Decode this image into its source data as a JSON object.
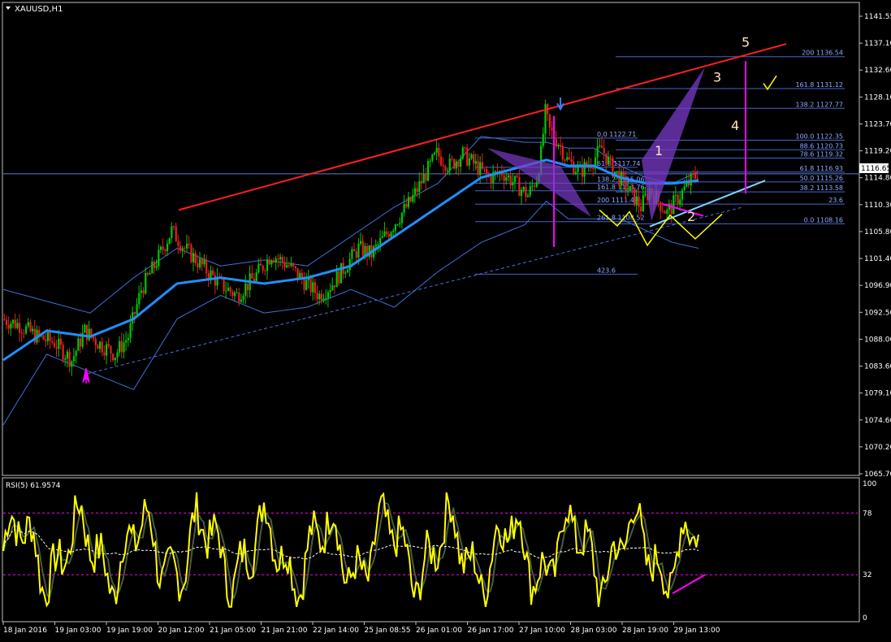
{
  "main_panel": {
    "title": "XAUUSD,H1",
    "current_price_label": "1116.65"
  },
  "rsi_panel": {
    "title": "RSI(5) 61.9574"
  },
  "colors": {
    "background": "#000000",
    "bull_candle": "#00c800",
    "bear_candle": "#e62020",
    "moving_average": "#1e90ff",
    "bollinger": "#3f6fd8",
    "trend_red": "#ff2020",
    "trend_cyan": "#7fd4ff",
    "fib": "#4466cc",
    "fib_text": "#8fa8ff",
    "rsi_line": "#ffff00",
    "magenta": "#ff00ff",
    "wave_label": "#ffe4c0",
    "zigzag": "#ffff00"
  },
  "chart_data": [
    {
      "type": "candlestick",
      "symbol": "XAUUSD",
      "timeframe": "H1",
      "y_axis_ticks": [
        "1141.55",
        "1137.10",
        "1132.60",
        "1128.10",
        "1123.70",
        "1119.20",
        "1114.80",
        "1110.30",
        "1105.80",
        "1101.40",
        "1096.90",
        "1092.50",
        "1088.00",
        "1083.60",
        "1079.10",
        "1074.60",
        "1070.20",
        "1065.70"
      ],
      "ylim": [
        1065.7,
        1143.4
      ],
      "x_axis_ticks": [
        "18 Jan 2016",
        "19 Jan 03:00",
        "19 Jan 19:00",
        "20 Jan 12:00",
        "21 Jan 05:00",
        "21 Jan 21:00",
        "22 Jan 14:00",
        "25 Jan 08:55",
        "26 Jan 01:00",
        "26 Jan 17:00",
        "27 Jan 10:00",
        "28 Jan 03:00",
        "28 Jan 19:00",
        "29 Jan 13:00"
      ],
      "price_path": [
        [
          0,
          1092
        ],
        [
          8,
          1091
        ],
        [
          16,
          1089
        ],
        [
          24,
          1088
        ],
        [
          32,
          1085
        ],
        [
          38,
          1090
        ],
        [
          44,
          1088
        ],
        [
          52,
          1086
        ],
        [
          58,
          1089
        ],
        [
          64,
          1097
        ],
        [
          70,
          1101
        ],
        [
          78,
          1107
        ],
        [
          84,
          1104
        ],
        [
          92,
          1101
        ],
        [
          100,
          1098
        ],
        [
          108,
          1096
        ],
        [
          116,
          1099
        ],
        [
          124,
          1103
        ],
        [
          132,
          1101
        ],
        [
          140,
          1098
        ],
        [
          146,
          1096
        ],
        [
          152,
          1098
        ],
        [
          158,
          1101
        ],
        [
          164,
          1104
        ],
        [
          170,
          1103
        ],
        [
          176,
          1106
        ],
        [
          182,
          1109
        ],
        [
          188,
          1112
        ],
        [
          194,
          1116
        ],
        [
          200,
          1120
        ],
        [
          206,
          1118
        ],
        [
          212,
          1120
        ],
        [
          218,
          1118
        ],
        [
          224,
          1116
        ],
        [
          230,
          1117
        ],
        [
          236,
          1115
        ],
        [
          242,
          1113
        ],
        [
          246,
          1116
        ],
        [
          248,
          1120
        ],
        [
          250,
          1127
        ],
        [
          252,
          1124
        ],
        [
          256,
          1122
        ],
        [
          260,
          1119
        ],
        [
          266,
          1117
        ],
        [
          272,
          1119
        ],
        [
          276,
          1121
        ],
        [
          280,
          1118
        ],
        [
          284,
          1116
        ],
        [
          290,
          1113
        ],
        [
          294,
          1111
        ],
        [
          298,
          1114
        ],
        [
          302,
          1112
        ],
        [
          306,
          1110
        ],
        [
          312,
          1113
        ],
        [
          316,
          1115
        ],
        [
          320,
          1116.65
        ]
      ],
      "moving_average": [
        [
          0,
          1085
        ],
        [
          20,
          1090
        ],
        [
          40,
          1089
        ],
        [
          60,
          1092
        ],
        [
          80,
          1098
        ],
        [
          100,
          1099
        ],
        [
          120,
          1098
        ],
        [
          140,
          1099
        ],
        [
          160,
          1101
        ],
        [
          180,
          1106
        ],
        [
          200,
          1111
        ],
        [
          220,
          1116
        ],
        [
          240,
          1118
        ],
        [
          250,
          1119
        ],
        [
          260,
          1118
        ],
        [
          272,
          1118
        ],
        [
          284,
          1116
        ],
        [
          296,
          1115
        ],
        [
          308,
          1115
        ],
        [
          320,
          1115.5
        ]
      ],
      "bollinger_upper": [
        [
          0,
          1097
        ],
        [
          20,
          1095
        ],
        [
          40,
          1093
        ],
        [
          60,
          1099
        ],
        [
          80,
          1104
        ],
        [
          100,
          1101
        ],
        [
          120,
          1102
        ],
        [
          140,
          1101
        ],
        [
          160,
          1106
        ],
        [
          180,
          1111
        ],
        [
          200,
          1115
        ],
        [
          220,
          1123
        ],
        [
          240,
          1122
        ],
        [
          250,
          1122
        ],
        [
          260,
          1121
        ],
        [
          272,
          1121
        ],
        [
          284,
          1118
        ],
        [
          296,
          1116
        ],
        [
          308,
          1115
        ],
        [
          320,
          1117
        ]
      ],
      "bollinger_lower": [
        [
          0,
          1074
        ],
        [
          20,
          1086
        ],
        [
          40,
          1083
        ],
        [
          60,
          1080
        ],
        [
          80,
          1092
        ],
        [
          100,
          1096
        ],
        [
          120,
          1093
        ],
        [
          140,
          1094
        ],
        [
          160,
          1097
        ],
        [
          180,
          1094
        ],
        [
          200,
          1100
        ],
        [
          220,
          1105
        ],
        [
          240,
          1108
        ],
        [
          250,
          1112
        ],
        [
          260,
          1109
        ],
        [
          272,
          1109
        ],
        [
          284,
          1109
        ],
        [
          296,
          1107
        ],
        [
          308,
          1105
        ],
        [
          320,
          1104
        ]
      ],
      "fib_levels_left": [
        {
          "label": "0.0 1122.71",
          "price": 1122.71
        },
        {
          "label": "61.8 1117.74",
          "price": 1117.74
        },
        {
          "label": "138.2 1115.06",
          "price": 1115.06
        },
        {
          "label": "161.8 1113.76",
          "price": 1113.76
        },
        {
          "label": "200 1111.49",
          "price": 1111.49
        },
        {
          "label": "261.8 1108.52",
          "price": 1108.52
        },
        {
          "label": "423.6",
          "price": 1099.6
        }
      ],
      "fib_levels_right": [
        {
          "label": "200 1136.54",
          "price": 1136.54
        },
        {
          "label": "161.8 1131.12",
          "price": 1131.12
        },
        {
          "label": "138.2 1127.77",
          "price": 1127.77
        },
        {
          "label": "100.0 1122.35",
          "price": 1122.35
        },
        {
          "label": "88.6 1120.73",
          "price": 1120.73
        },
        {
          "label": "78.6 1119.32",
          "price": 1119.32
        },
        {
          "label": "61.8 1116.93",
          "price": 1116.93
        },
        {
          "label": "50.0 1115.26",
          "price": 1115.26
        },
        {
          "label": "38.2 1113.58",
          "price": 1113.58
        },
        {
          "label": "23.6",
          "price": 1111.5
        },
        {
          "label": "0.0 1108.16",
          "price": 1108.16
        }
      ],
      "wave_labels": [
        "1",
        "2",
        "3",
        "4",
        "5"
      ]
    },
    {
      "type": "line",
      "indicator": "RSI(5)",
      "value": 61.9574,
      "y_axis_ticks": [
        "100",
        "78",
        "32",
        "0"
      ],
      "levels": [
        78,
        32
      ],
      "ylim": [
        0,
        100
      ]
    }
  ]
}
